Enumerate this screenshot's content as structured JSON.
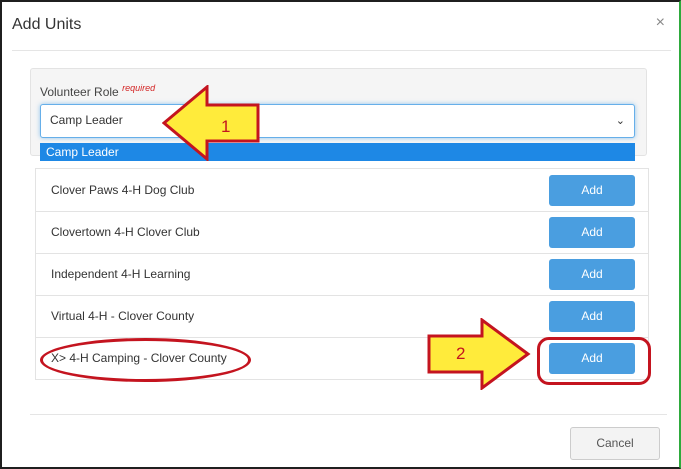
{
  "modal": {
    "title": "Add Units",
    "close_glyph": "×"
  },
  "role": {
    "label": "Volunteer Role",
    "required_tag": "required",
    "selected_value": "Camp Leader",
    "highlighted_option": "Camp Leader",
    "chevron_glyph": "⌄"
  },
  "units": [
    {
      "name": "Clover Paws 4-H Dog Club",
      "button": "Add"
    },
    {
      "name": "Clovertown 4-H Clover Club",
      "button": "Add"
    },
    {
      "name": "Independent 4-H Learning",
      "button": "Add"
    },
    {
      "name": "Virtual 4-H - Clover County",
      "button": "Add"
    },
    {
      "name": "X> 4-H Camping - Clover County",
      "button": "Add"
    }
  ],
  "footer": {
    "cancel_label": "Cancel"
  },
  "annotations": {
    "arrow1_label": "1",
    "arrow2_label": "2"
  },
  "colors": {
    "primary_button": "#4a9ee0",
    "selected_option": "#1e88e5",
    "annotation_red": "#c4141f",
    "annotation_yellow": "#ffeb3b",
    "required": "#d32424",
    "frame_green": "#2eaa3c"
  }
}
